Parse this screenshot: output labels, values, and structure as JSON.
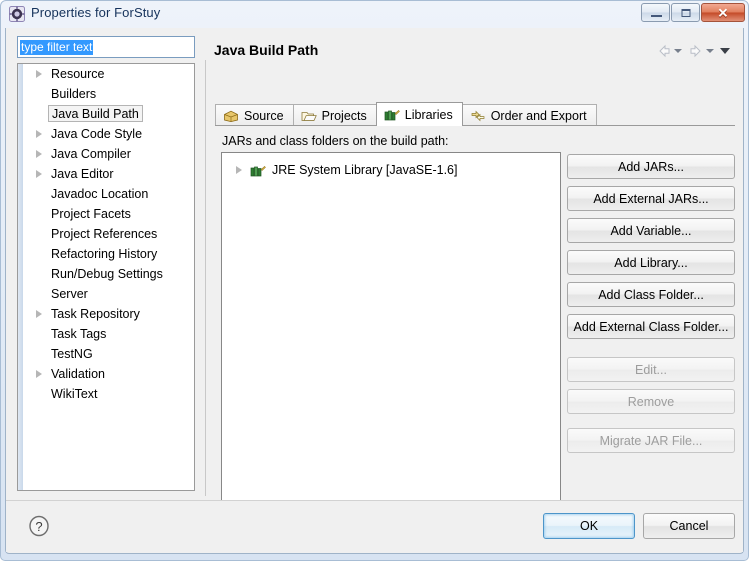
{
  "window": {
    "title": "Properties for ForStuy",
    "icon": "eclipse-properties-icon",
    "minimize_label": "Minimize",
    "maximize_label": "Restore",
    "close_label": "Close",
    "close_glyph": "✕"
  },
  "filter": {
    "value": "type filter text",
    "placeholder": "type filter text"
  },
  "sidebar": {
    "items": [
      {
        "label": "Resource",
        "expandable": true,
        "selected": false
      },
      {
        "label": "Builders",
        "expandable": false,
        "selected": false
      },
      {
        "label": "Java Build Path",
        "expandable": false,
        "selected": true
      },
      {
        "label": "Java Code Style",
        "expandable": true,
        "selected": false
      },
      {
        "label": "Java Compiler",
        "expandable": true,
        "selected": false
      },
      {
        "label": "Java Editor",
        "expandable": true,
        "selected": false
      },
      {
        "label": "Javadoc Location",
        "expandable": false,
        "selected": false
      },
      {
        "label": "Project Facets",
        "expandable": false,
        "selected": false
      },
      {
        "label": "Project References",
        "expandable": false,
        "selected": false
      },
      {
        "label": "Refactoring History",
        "expandable": false,
        "selected": false
      },
      {
        "label": "Run/Debug Settings",
        "expandable": false,
        "selected": false
      },
      {
        "label": "Server",
        "expandable": false,
        "selected": false
      },
      {
        "label": "Task Repository",
        "expandable": true,
        "selected": false
      },
      {
        "label": "Task Tags",
        "expandable": false,
        "selected": false
      },
      {
        "label": "TestNG",
        "expandable": false,
        "selected": false
      },
      {
        "label": "Validation",
        "expandable": true,
        "selected": false
      },
      {
        "label": "WikiText",
        "expandable": false,
        "selected": false
      }
    ]
  },
  "page": {
    "title": "Java Build Path",
    "nav": {
      "back_icon": "back-arrow-icon",
      "back_dropdown_icon": "chevron-down-icon",
      "forward_icon": "forward-arrow-icon",
      "forward_dropdown_icon": "chevron-down-icon",
      "menu_icon": "chevron-down-icon"
    },
    "tabs": [
      {
        "label": "Source",
        "icon": "source-package-icon",
        "active": false
      },
      {
        "label": "Projects",
        "icon": "open-folder-icon",
        "active": false
      },
      {
        "label": "Libraries",
        "icon": "library-books-icon",
        "active": true
      },
      {
        "label": "Order and Export",
        "icon": "order-export-icon",
        "active": false
      }
    ],
    "list_label": "JARs and class folders on the build path:",
    "list_items": [
      {
        "label": "JRE System Library [JavaSE-1.6]",
        "icon": "library-books-icon",
        "expandable": true
      }
    ],
    "side_buttons": [
      {
        "label": "Add JARs...",
        "enabled": true
      },
      {
        "label": "Add External JARs...",
        "enabled": true
      },
      {
        "label": "Add Variable...",
        "enabled": true
      },
      {
        "label": "Add Library...",
        "enabled": true
      },
      {
        "label": "Add Class Folder...",
        "enabled": true
      },
      {
        "label": "Add External Class Folder...",
        "enabled": true
      },
      {
        "label": "Edit...",
        "enabled": false
      },
      {
        "label": "Remove",
        "enabled": false
      },
      {
        "label": "Migrate JAR File...",
        "enabled": false
      }
    ]
  },
  "footer": {
    "help_icon": "help-question-icon",
    "ok_label": "OK",
    "cancel_label": "Cancel"
  },
  "colors": {
    "selection_blue": "#3399ff",
    "default_button_border": "#4d95c9",
    "title_text": "#15325b",
    "disabled_text": "#9d9d9d"
  }
}
